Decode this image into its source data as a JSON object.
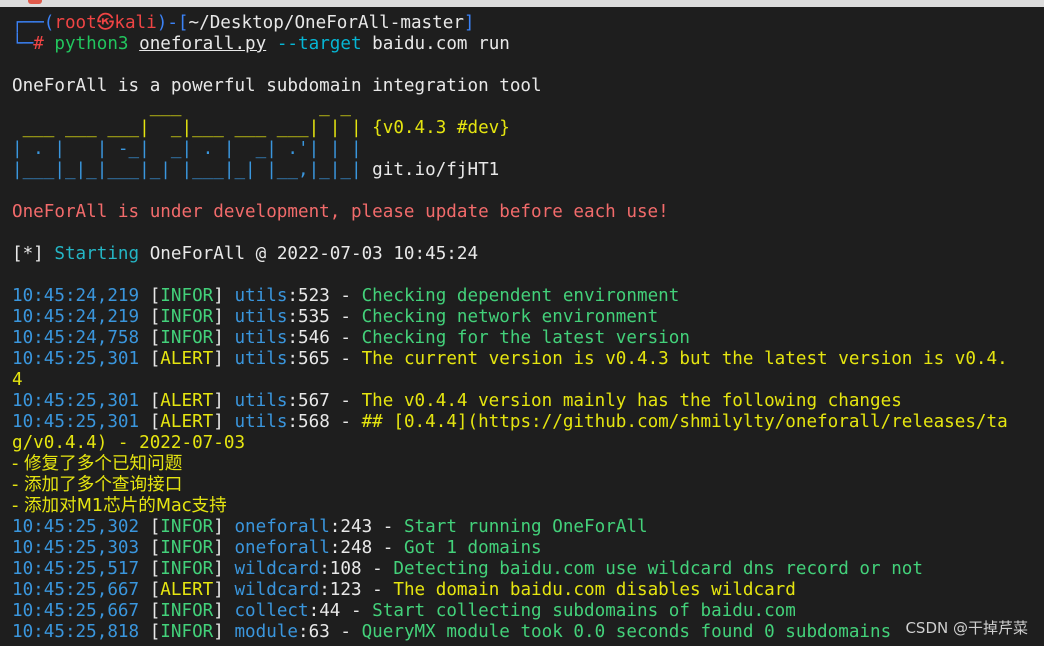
{
  "prompt": {
    "box_open": "┌──(",
    "user": "root",
    "at": "㉿",
    "host": "kali",
    "mid": ")-[",
    "path": "~/Desktop/OneForAll-master",
    "close": "]",
    "box_close": "└─",
    "hash": "#",
    "cmd_python": "python3",
    "cmd_file": "oneforall.py",
    "cmd_flag": "--target",
    "cmd_arg": "baidu.com run"
  },
  "intro": "OneForAll is a powerful subdomain integration tool",
  "banner": {
    "line1": "             ___             _ _",
    "line2": " ___ ___ ___|  _|___ ___ ___| | |",
    "line3": "| . |   | -_|  _| . |  _| .'| | |",
    "line4": "|___|_|_|___|_| |___|_| |__,|_|_|",
    "version": "{v0.4.3 #dev}",
    "link": "git.io/fjHT1"
  },
  "warning": "OneForAll is under development, please update before each use!",
  "starting": {
    "prefix": "[*] ",
    "word": "Starting",
    "rest": " OneForAll @ 2022-07-03 10:45:24"
  },
  "log": [
    {
      "time": "10:45:24,219",
      "level": "INFOR",
      "mod": "utils",
      "line": "523",
      "msg": "Checking dependent environment",
      "kind": "info"
    },
    {
      "time": "10:45:24,219",
      "level": "INFOR",
      "mod": "utils",
      "line": "535",
      "msg": "Checking network environment",
      "kind": "info"
    },
    {
      "time": "10:45:24,758",
      "level": "INFOR",
      "mod": "utils",
      "line": "546",
      "msg": "Checking for the latest version",
      "kind": "info"
    },
    {
      "time": "10:45:25,301",
      "level": "ALERT",
      "mod": "utils",
      "line": "565",
      "msg": "The current version is v0.4.3 but the latest version is v0.4.",
      "kind": "alert"
    }
  ],
  "wrap1": "4",
  "log2": [
    {
      "time": "10:45:25,301",
      "level": "ALERT",
      "mod": "utils",
      "line": "567",
      "msg": "The v0.4.4 version mainly has the following changes",
      "kind": "alert"
    },
    {
      "time": "10:45:25,301",
      "level": "ALERT",
      "mod": "utils",
      "line": "568",
      "msg": "## [0.4.4](https://github.com/shmilylty/oneforall/releases/ta",
      "kind": "alert"
    }
  ],
  "wrap2": "g/v0.4.4) - 2022-07-03",
  "changes": [
    "- 修复了多个已知问题",
    "- 添加了多个查询接口",
    "- 添加对M1芯片的Mac支持"
  ],
  "log3": [
    {
      "time": "10:45:25,302",
      "level": "INFOR",
      "mod": "oneforall",
      "line": "243",
      "msg": "Start running OneForAll",
      "kind": "info"
    },
    {
      "time": "10:45:25,303",
      "level": "INFOR",
      "mod": "oneforall",
      "line": "248",
      "msg": "Got 1 domains",
      "kind": "info"
    },
    {
      "time": "10:45:25,517",
      "level": "INFOR",
      "mod": "wildcard",
      "line": "108",
      "msg": "Detecting baidu.com use wildcard dns record or not",
      "kind": "info"
    },
    {
      "time": "10:45:25,667",
      "level": "ALERT",
      "mod": "wildcard",
      "line": "123",
      "msg": "The domain baidu.com disables wildcard",
      "kind": "alert"
    },
    {
      "time": "10:45:25,667",
      "level": "INFOR",
      "mod": "collect",
      "line": "44",
      "msg": "Start collecting subdomains of baidu.com",
      "kind": "info"
    },
    {
      "time": "10:45:25,818",
      "level": "INFOR",
      "mod": "module",
      "line": "63",
      "msg": "QueryMX module took 0.0 seconds found 0 subdomains",
      "kind": "info"
    }
  ],
  "watermark": "CSDN @干掉芹菜"
}
